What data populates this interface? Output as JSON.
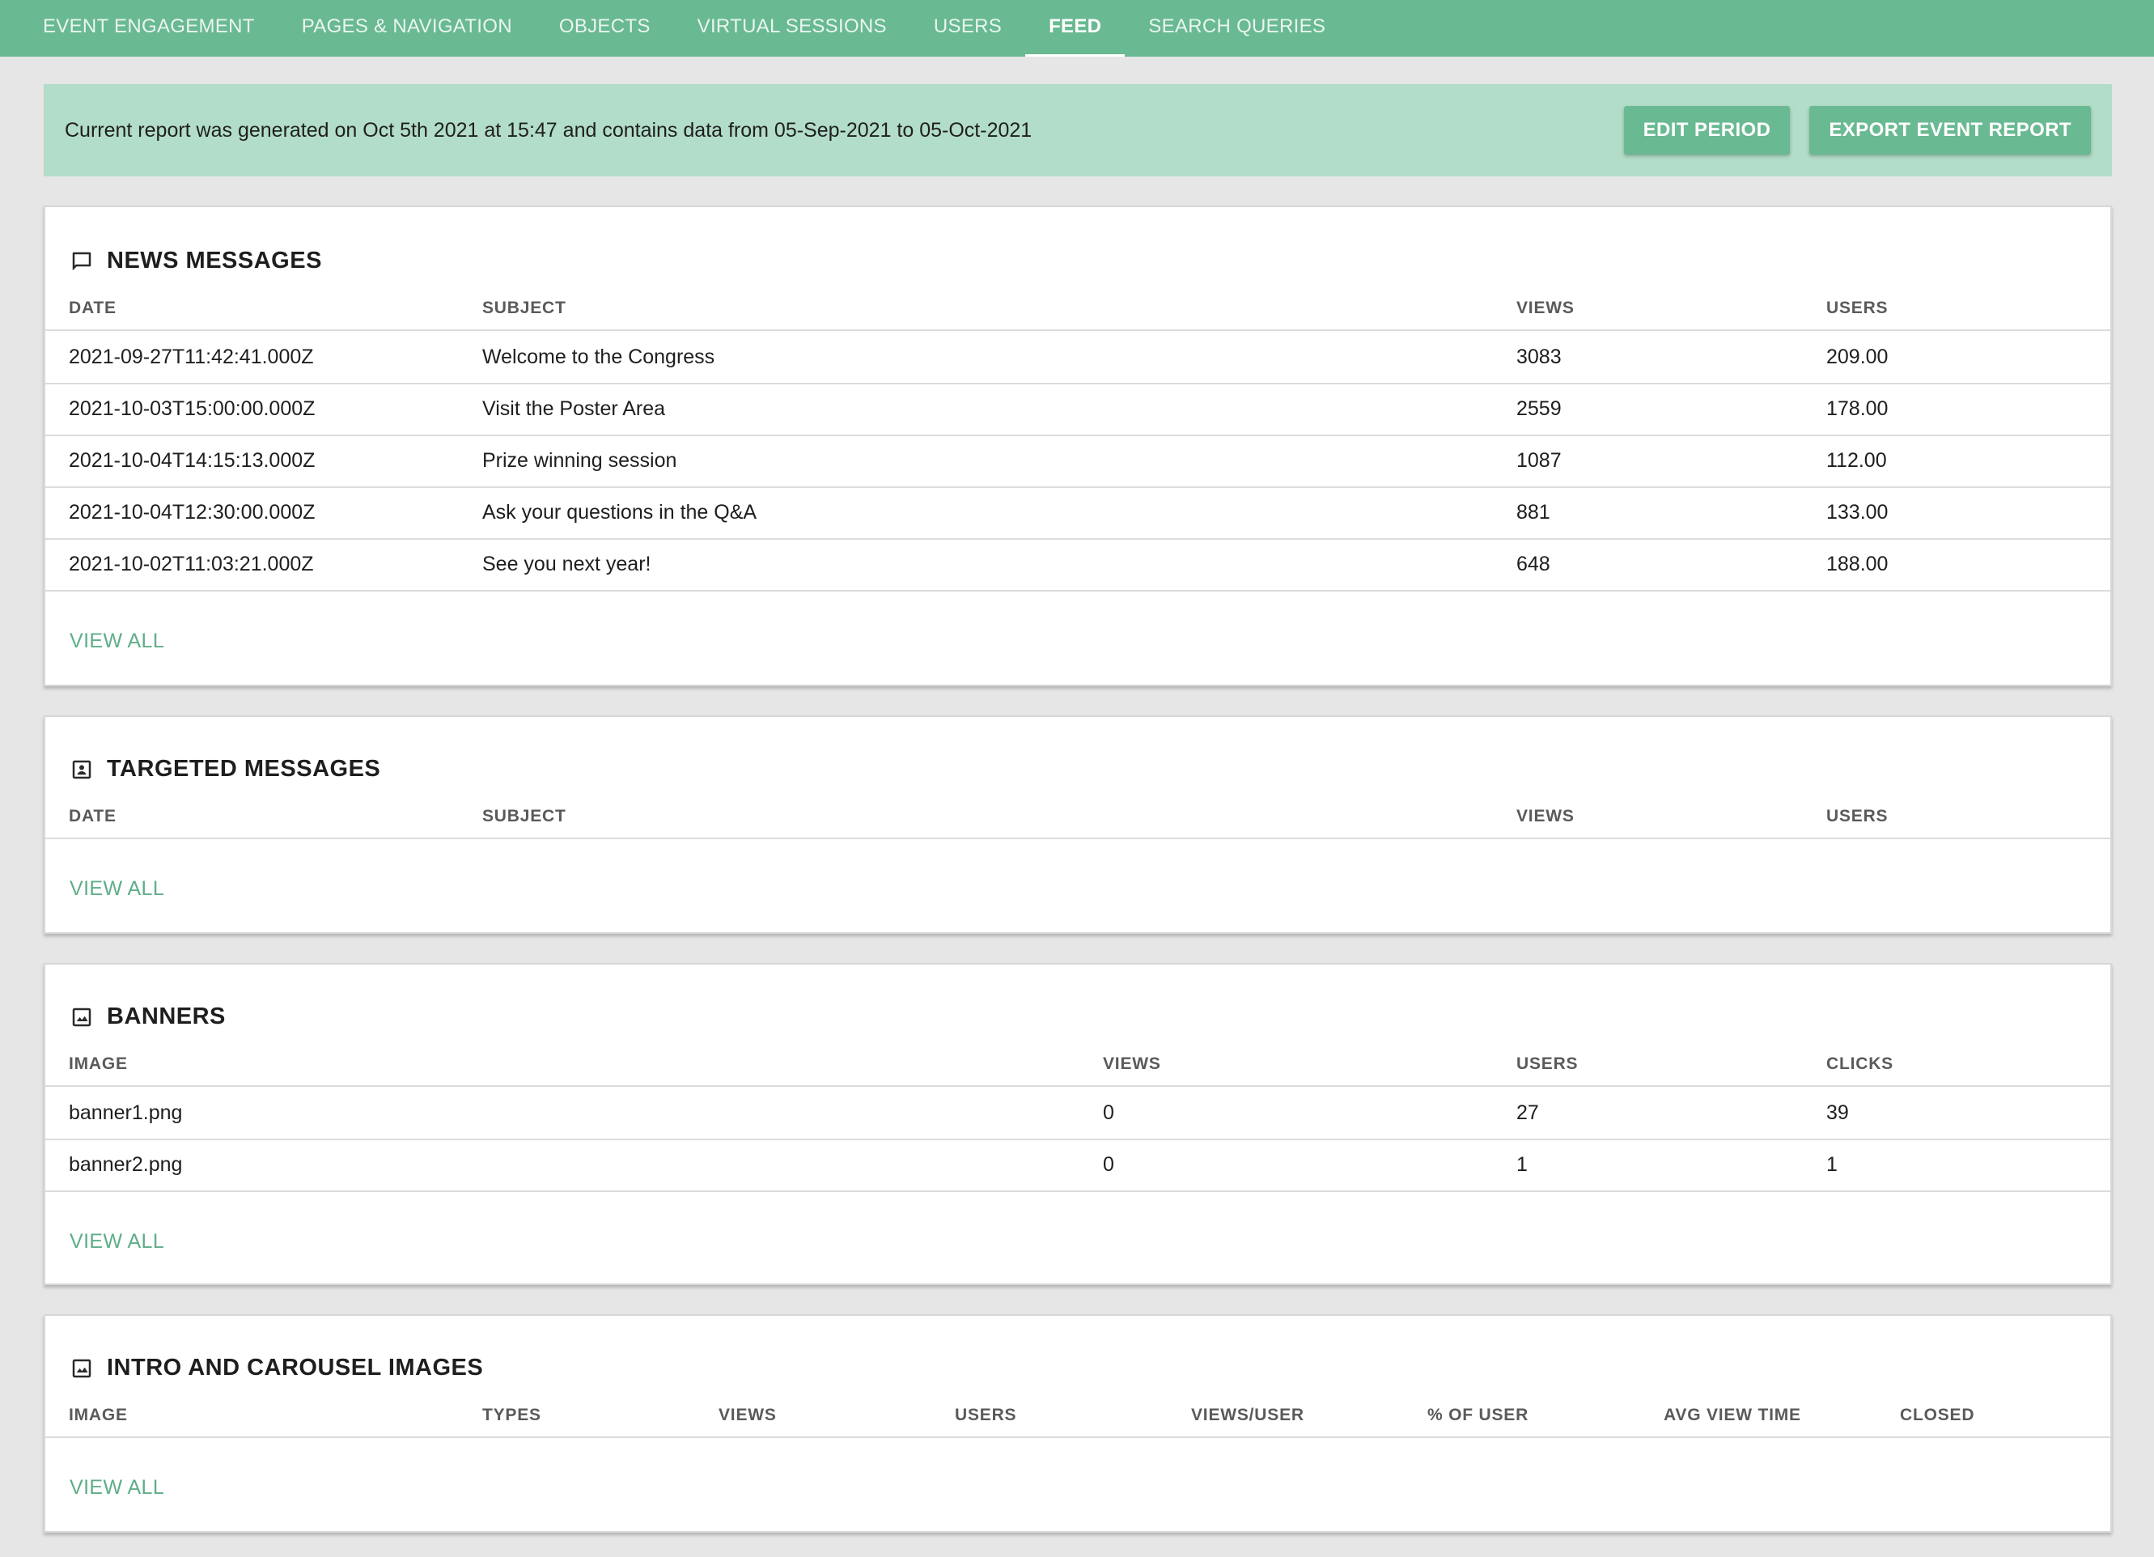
{
  "nav": {
    "tabs": [
      {
        "label": "EVENT ENGAGEMENT"
      },
      {
        "label": "PAGES & NAVIGATION"
      },
      {
        "label": "OBJECTS"
      },
      {
        "label": "VIRTUAL SESSIONS"
      },
      {
        "label": "USERS"
      },
      {
        "label": "FEED",
        "active": true
      },
      {
        "label": "SEARCH QUERIES"
      }
    ]
  },
  "info": {
    "text": "Current report was generated on Oct 5th 2021 at 15:47 and contains data from 05-Sep-2021 to 05-Oct-2021",
    "edit_period_label": "EDIT PERIOD",
    "export_label": "EXPORT EVENT REPORT"
  },
  "news": {
    "title": "NEWS MESSAGES",
    "icon": "comment-icon",
    "columns": [
      "DATE",
      "SUBJECT",
      "VIEWS",
      "USERS"
    ],
    "rows": [
      {
        "date": "2021-09-27T11:42:41.000Z",
        "subject": "Welcome to the Congress",
        "views": "3083",
        "users": "209.00"
      },
      {
        "date": "2021-10-03T15:00:00.000Z",
        "subject": "Visit the Poster Area",
        "views": "2559",
        "users": "178.00"
      },
      {
        "date": "2021-10-04T14:15:13.000Z",
        "subject": "Prize winning session",
        "views": "1087",
        "users": "112.00"
      },
      {
        "date": "2021-10-04T12:30:00.000Z",
        "subject": "Ask your questions in the Q&A",
        "views": "881",
        "users": "133.00"
      },
      {
        "date": "2021-10-02T11:03:21.000Z",
        "subject": "See you next year!",
        "views": "648",
        "users": "188.00"
      }
    ],
    "view_all": "VIEW ALL"
  },
  "targeted": {
    "title": "TARGETED MESSAGES",
    "icon": "contact-card-icon",
    "columns": [
      "DATE",
      "SUBJECT",
      "VIEWS",
      "USERS"
    ],
    "rows": [],
    "view_all": "VIEW ALL"
  },
  "banners": {
    "title": "BANNERS",
    "icon": "image-icon",
    "columns": [
      "IMAGE",
      "VIEWS",
      "USERS",
      "CLICKS"
    ],
    "rows": [
      {
        "image": "banner1.png",
        "views": "0",
        "users": "27",
        "clicks": "39"
      },
      {
        "image": "banner2.png",
        "views": "0",
        "users": "1",
        "clicks": "1"
      }
    ],
    "view_all": "VIEW ALL"
  },
  "carousel": {
    "title": "INTRO AND CAROUSEL IMAGES",
    "icon": "image-icon",
    "columns": [
      "IMAGE",
      "TYPES",
      "VIEWS",
      "USERS",
      "VIEWS/USER",
      "% OF USER",
      "AVG VIEW TIME",
      "CLOSED"
    ],
    "rows": [],
    "view_all": "VIEW ALL"
  },
  "colors": {
    "primary": "#69b992",
    "banner_bg": "#b2ddc8",
    "link": "#5fae88",
    "page_bg": "#e6e6e6"
  }
}
